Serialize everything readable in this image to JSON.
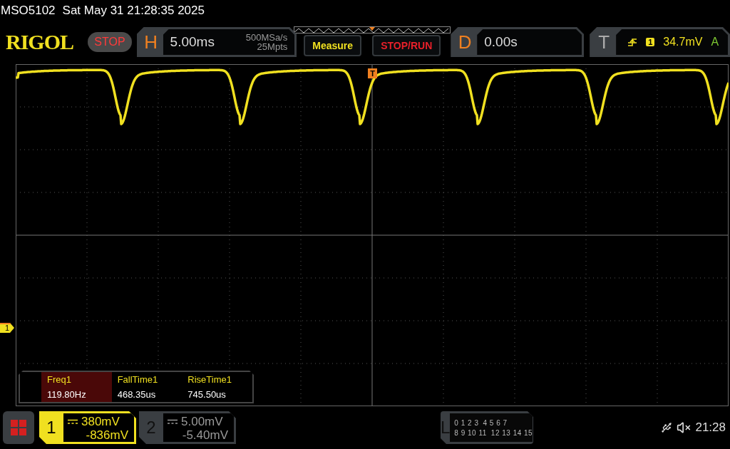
{
  "header": {
    "model": "MSO5102",
    "datetime": "Sat May 31 21:28:35 2025"
  },
  "logo": "RIGOL",
  "run_state": {
    "label": "STOP"
  },
  "horizontal": {
    "label": "H",
    "timebase": "5.00ms",
    "sample_rate": "500MSa/s",
    "memory_depth": "25Mpts"
  },
  "buttons": [
    {
      "label": "Measure",
      "kind": "menu"
    },
    {
      "label": "STOP/RUN",
      "kind": "run"
    }
  ],
  "delay": {
    "label": "D",
    "value": "0.00s"
  },
  "trigger": {
    "label": "T",
    "source": "1",
    "level": "34.7mV",
    "mode": "A"
  },
  "markers": {
    "trigger": "T",
    "channel": "1"
  },
  "measurements": [
    {
      "name": "Freq1",
      "value": "119.80Hz",
      "selected": true
    },
    {
      "name": "FallTime1",
      "value": "468.35us",
      "selected": false
    },
    {
      "name": "RiseTime1",
      "value": "745.50us",
      "selected": false
    }
  ],
  "channels": [
    {
      "number": "1",
      "scale": "380mV",
      "offset": "-836mV",
      "active": true
    },
    {
      "number": "2",
      "scale": "5.00mV",
      "offset": "-5.40mV",
      "active": false
    }
  ],
  "logic": {
    "label": "L",
    "rows": [
      [
        "0 1 2 3",
        "4 5 6 7"
      ],
      [
        "8 9 10 11",
        "12 13 14 15"
      ]
    ]
  },
  "status": {
    "time": "21:28"
  }
}
